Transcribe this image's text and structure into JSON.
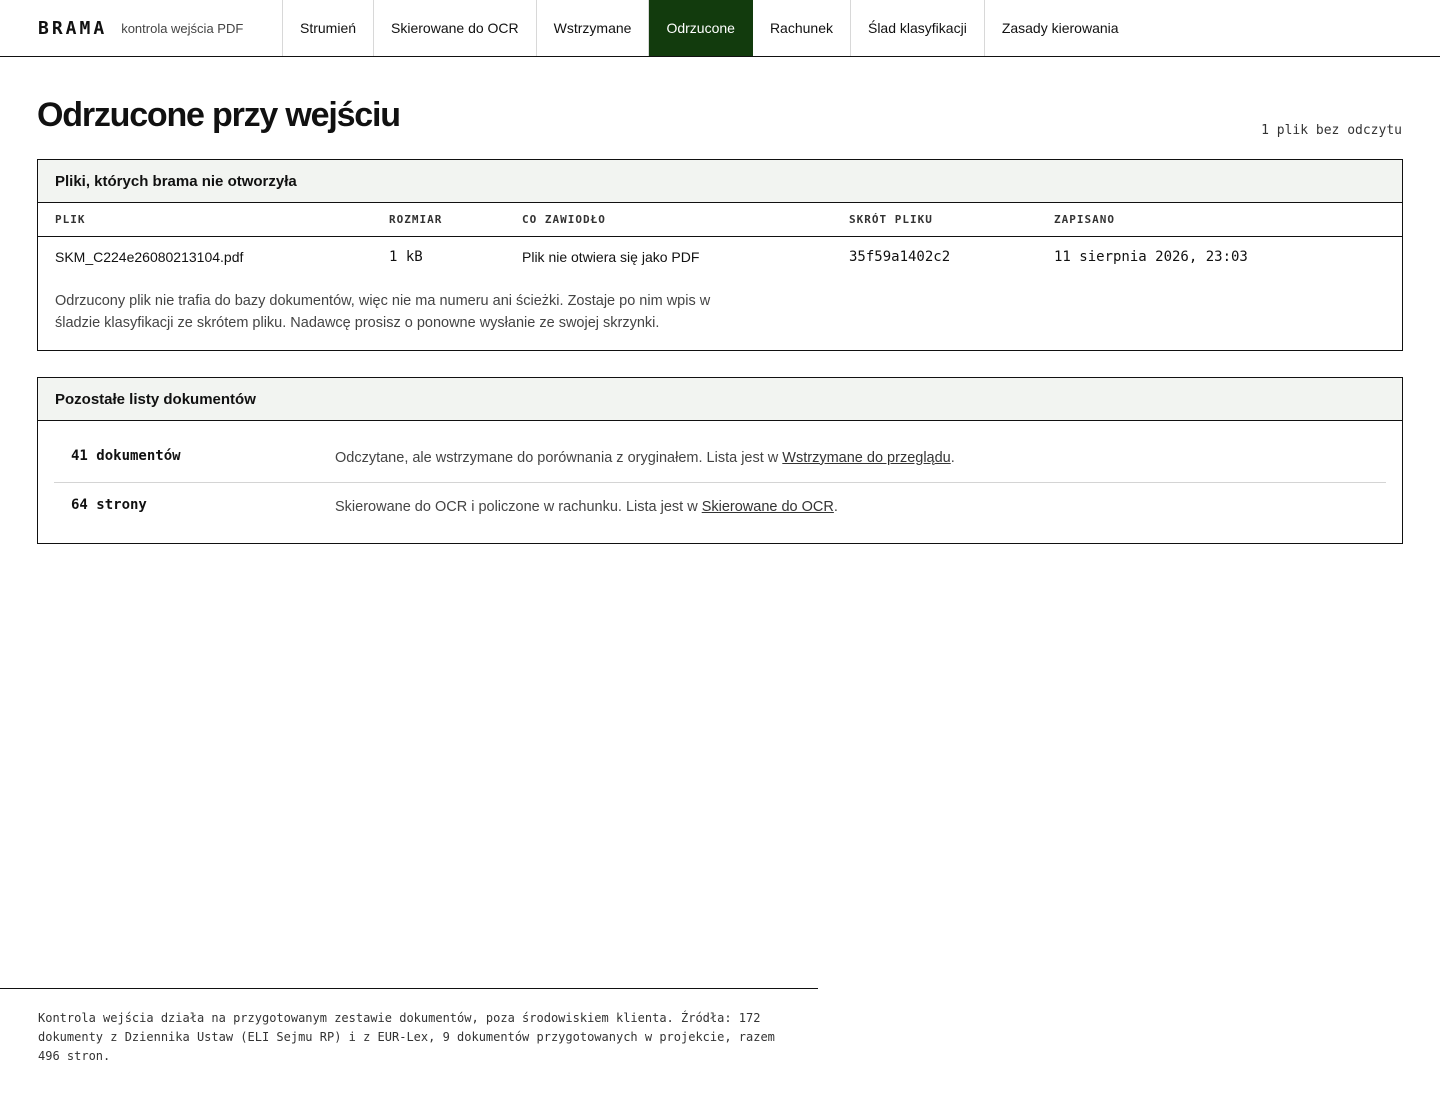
{
  "brand": {
    "name": "BRAMA",
    "subtitle": "kontrola wejścia PDF"
  },
  "nav": [
    {
      "label": "Strumień"
    },
    {
      "label": "Skierowane do OCR"
    },
    {
      "label": "Wstrzymane"
    },
    {
      "label": "Odrzucone",
      "active": true
    },
    {
      "label": "Rachunek"
    },
    {
      "label": "Ślad klasyfikacji"
    },
    {
      "label": "Zasady kierowania"
    }
  ],
  "page": {
    "title": "Odrzucone przy wejściu",
    "meta": "1 plik bez odczytu"
  },
  "rejected": {
    "heading": "Pliki, których brama nie otworzyła",
    "columns": [
      "PLIK",
      "ROZMIAR",
      "CO ZAWIODŁO",
      "SKRÓT PLIKU",
      "ZAPISANO"
    ],
    "rows": [
      {
        "file": "SKM_C224e26080213104.pdf",
        "size": "1 kB",
        "failure": "Plik nie otwiera się jako PDF",
        "hash": "35f59a1402c2",
        "saved": "11 sierpnia 2026, 23:03"
      }
    ],
    "note": "Odrzucony plik nie trafia do bazy dokumentów, więc nie ma numeru ani ścieżki. Zostaje po nim wpis w śladzie klasyfikacji ze skrótem pliku. Nadawcę prosisz o ponowne wysłanie ze swojej skrzynki."
  },
  "other_lists": {
    "heading": "Pozostałe listy dokumentów",
    "items": [
      {
        "count": "41 dokumentów",
        "text": "Odczytane, ale wstrzymane do porównania z oryginałem. Lista jest w ",
        "link": "Wstrzymane do przeglądu",
        "suffix": "."
      },
      {
        "count": "64 strony",
        "text": "Skierowane do OCR i policzone w rachunku. Lista jest w ",
        "link": "Skierowane do OCR",
        "suffix": "."
      }
    ]
  },
  "footer": {
    "text": "Kontrola wejścia działa na przygotowanym zestawie dokumentów, poza środowiskiem klienta. Źródła: 172 dokumenty z Dziennika Ustaw (ELI Sejmu RP) i z EUR-Lex, 9 dokumentów przygotowanych w projekcie, razem 496 stron."
  },
  "colors": {
    "nav_active_bg": "#123b0d",
    "panel_header_bg": "#f2f4f1"
  }
}
